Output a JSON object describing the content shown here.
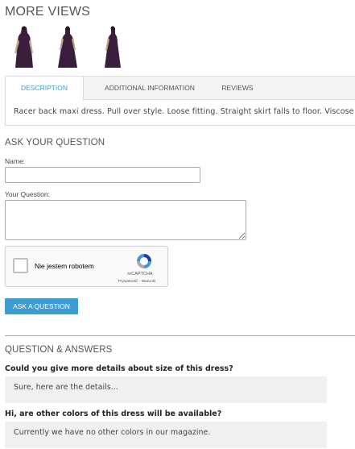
{
  "more_views": {
    "title": "MORE VIEWS",
    "thumbnails": [
      {
        "alt": "dress-view-front"
      },
      {
        "alt": "dress-view-back"
      },
      {
        "alt": "dress-view-side"
      }
    ]
  },
  "tabs": {
    "items": [
      {
        "label": "DESCRIPTION",
        "active": true
      },
      {
        "label": "ADDITIONAL INFORMATION",
        "active": false
      },
      {
        "label": "REVIEWS",
        "active": false
      }
    ],
    "description_text": "Racer back maxi dress. Pull over style. Loose fitting. Straight skirt falls to floor. Viscose"
  },
  "ask_question": {
    "title": "ASK YOUR QUESTION",
    "name_label": "Name:",
    "name_value": "",
    "question_label": "Your Question:",
    "question_value": "",
    "recaptcha": {
      "label": "Nie jestem robotem",
      "brand": "reCAPTCHA",
      "links": "Prywatność - Warunki"
    },
    "submit_label": "ASK A QUESTION"
  },
  "qa": {
    "title": "QUESTION & ANSWERS",
    "items": [
      {
        "question": "Could you give more details about size of this dress?",
        "answer": "Sure, here are the details..."
      },
      {
        "question": "Hi, are other colors of this dress will be available?",
        "answer": "Currently we have no other colors in our magazine."
      }
    ]
  },
  "colors": {
    "accent": "#3d9cd2",
    "dress": "#3a1f3d",
    "answer_bg": "#f0f0f0"
  }
}
